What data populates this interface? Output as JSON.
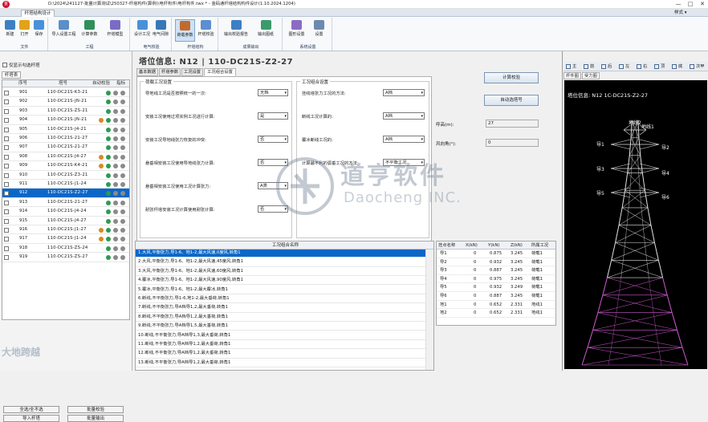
{
  "window": {
    "title": "D:\\2024\\241127-批量计算测试\\250327-杆塔构件(算例)\\电杆构件\\电杆构件.twx * - 金码通杆塔结构构件设计(1.10.2024.1204)",
    "logo_text": "金",
    "controls": [
      "—",
      "□",
      "✕"
    ]
  },
  "menu": {
    "active_tab": "杆塔结构设计",
    "skin_label": "样式 ▾"
  },
  "ribbon": {
    "groups": [
      {
        "label": "文件",
        "buttons": [
          {
            "label": "新建",
            "icon": "new-file-icon"
          },
          {
            "label": "打开",
            "icon": "folder-open-icon"
          },
          {
            "label": "保存",
            "icon": "save-icon"
          }
        ]
      },
      {
        "label": "工程",
        "buttons": [
          {
            "label": "导入设置工程",
            "icon": "import-icon"
          },
          {
            "label": "计算参数",
            "icon": "parameters-icon"
          },
          {
            "label": "杆塔模型",
            "icon": "tower-model-icon"
          }
        ]
      },
      {
        "label": "电气校验",
        "buttons": [
          {
            "label": "设计工况",
            "icon": "grid-icon"
          },
          {
            "label": "电气间隙",
            "icon": "clearance-icon"
          }
        ]
      },
      {
        "label": "杆塔结构",
        "buttons": [
          {
            "label": "荷载参数",
            "icon": "load-icon"
          },
          {
            "label": "杆塔校验",
            "icon": "check-icon"
          }
        ]
      },
      {
        "label": "成果输出",
        "buttons": [
          {
            "label": "输出校验报告",
            "icon": "report-icon"
          },
          {
            "label": "输出图纸",
            "icon": "drawing-icon"
          }
        ]
      },
      {
        "label": "系统设置",
        "buttons": [
          {
            "label": "图形设置",
            "icon": "graphics-icon"
          },
          {
            "label": "设置",
            "icon": "settings-icon"
          }
        ]
      }
    ]
  },
  "left": {
    "only_show_checked": "仅显示勾选杆塔",
    "subtab": "杆塔表",
    "columns": [
      "序号",
      "塔号",
      "自动校验",
      "指标"
    ],
    "rows": [
      {
        "no": "901",
        "code": "110-DC21S-K3-21",
        "dots": [
          "#2e9a52",
          "#8a8a8a",
          "#8a8a8a"
        ]
      },
      {
        "no": "902",
        "code": "110-DC21S-JN-21",
        "dots": [
          "#2e9a52",
          "#8a8a8a",
          "#8a8a8a"
        ]
      },
      {
        "no": "903",
        "code": "110-DC21S-ZS-21",
        "dots": [
          "#2e9a52",
          "#8a8a8a",
          "#8a8a8a"
        ]
      },
      {
        "no": "904",
        "code": "110-DC21S-JN-21",
        "dots": [
          "#d88a1f",
          "#2e9a52",
          "#8a8a8a",
          "#8a8a8a"
        ]
      },
      {
        "no": "905",
        "code": "110-DC21S-J4-21",
        "dots": [
          "#2e9a52",
          "#8a8a8a",
          "#8a8a8a"
        ]
      },
      {
        "no": "906",
        "code": "110-DC21S-21-27",
        "dots": [
          "#2e9a52",
          "#8a8a8a",
          "#8a8a8a"
        ]
      },
      {
        "no": "907",
        "code": "110-DC21S-21-27",
        "dots": [
          "#2e9a52",
          "#8a8a8a",
          "#8a8a8a"
        ]
      },
      {
        "no": "908",
        "code": "110-DC21S-J4-27",
        "dots": [
          "#d88a1f",
          "#2e9a52",
          "#8a8a8a",
          "#8a8a8a"
        ]
      },
      {
        "no": "909",
        "code": "110-DC21S-K4-21",
        "dots": [
          "#d88a1f",
          "#2e9a52",
          "#8a8a8a",
          "#8a8a8a"
        ]
      },
      {
        "no": "910",
        "code": "110-DC21S-Z3-21",
        "dots": [
          "#2e9a52",
          "#8a8a8a",
          "#8a8a8a"
        ]
      },
      {
        "no": "911",
        "code": "110-DC21S-J1-24",
        "dots": [
          "#2e9a52",
          "#8a8a8a",
          "#8a8a8a"
        ]
      },
      {
        "no": "912",
        "code": "110-DC21S-Z2-27",
        "dots": [
          "#2e9a52",
          "#8a8a8a",
          "#8a8a8a"
        ],
        "selected": true
      },
      {
        "no": "913",
        "code": "110-DC21S-21-27",
        "dots": [
          "#2e9a52",
          "#8a8a8a",
          "#8a8a8a"
        ]
      },
      {
        "no": "914",
        "code": "110-DC21S-J4-24",
        "dots": [
          "#2e9a52",
          "#8a8a8a",
          "#8a8a8a"
        ]
      },
      {
        "no": "915",
        "code": "110-DC21S-J4-27",
        "dots": [
          "#2e9a52",
          "#8a8a8a",
          "#8a8a8a"
        ]
      },
      {
        "no": "916",
        "code": "110-DC21S-J1-27",
        "dots": [
          "#d88a1f",
          "#2e9a52",
          "#8a8a8a",
          "#8a8a8a"
        ]
      },
      {
        "no": "917",
        "code": "110-DC21S-J1-24",
        "dots": [
          "#d88a1f",
          "#2e9a52",
          "#8a8a8a",
          "#8a8a8a"
        ]
      },
      {
        "no": "918",
        "code": "110-DC21S-ZS-24",
        "dots": [
          "#2e9a52",
          "#8a8a8a",
          "#8a8a8a"
        ]
      },
      {
        "no": "919",
        "code": "110-DC21S-ZS-27",
        "dots": [
          "#2e9a52",
          "#8a8a8a",
          "#8a8a8a"
        ]
      }
    ],
    "buttons": [
      "全选/全不选",
      "批量校验",
      "导入杆塔",
      "批量输出"
    ]
  },
  "center": {
    "header": "塔位信息: N12 | 110-DC21S-Z2-27",
    "tabs": [
      "基本数据",
      "杆塔参数",
      "工况设置",
      "工况组合设置"
    ],
    "left_group": "荷载工况设置",
    "fields": [
      {
        "label": "导地线工况是否按照统一的一次:",
        "value": "无档"
      },
      {
        "label": "安装工况使用过项实例工况进行计算:",
        "value": "是"
      },
      {
        "label": "安装工况导地线张力恢复的冲突:",
        "value": "否"
      },
      {
        "label": "悬垂相安装工况使用导地线张力计算:",
        "value": "否"
      },
      {
        "label": "悬垂相安装工况使用工况计算张力:",
        "value": "A类"
      },
      {
        "label": "耐张杆塔安装工况计算使用耐张计算:",
        "value": "否"
      }
    ],
    "right_group": "工况组合设置",
    "rfields": [
      {
        "label": "挂线塔张力工况的方法:",
        "value": "A档"
      },
      {
        "label": "断线工况计算的:",
        "value": "A档"
      },
      {
        "label": "覆冰断线工况的:",
        "value": "A档"
      },
      {
        "label": "计算最不利的弧垂工况的方法:",
        "value": "不平衡工况"
      }
    ],
    "side_buttons": [
      "计算校验",
      "自动选塔号"
    ],
    "side_fields": [
      {
        "label": "呼高(m):",
        "value": "27"
      },
      {
        "label": "风向角(°):",
        "value": "0"
      }
    ],
    "combos_header": "工况组合名称",
    "combos": [
      "1.大风,平衡张力,导1-6、地1-2,最大风速,0度风,转角1",
      "2.大风,平衡张力,导1-6、地1-2,最大风速,45度风,转角1",
      "3.大风,平衡张力,导1-6、地1-2,最大风速,60度风,转角1",
      "4.覆冰,平衡张力,导1-6、地1-2,最大风速,90度风,转角1",
      "5.覆冰,平衡张力,导1-6、地1-2,最大覆冰,转角1",
      "6.断线,不平衡张力,导1-6,地1-2,最大垂荷,转角1",
      "7.断线,不平衡张力,导A档导1,2,最大垂荷,转角1",
      "8.断线,不平衡张力,导A档导1,2,最大垂荷,转角1",
      "9.断线,不平衡张力,导A档导1,5,最大垂荷,转角1",
      "10.断线,不平衡张力,导A档导1,3,最大垂荷,转角1",
      "11.断线,不平衡张力,导A档导1,2,最大垂荷,转角1",
      "12.断线,不平衡张力,导A档导1,2,最大垂荷,转角1",
      "13.断线,不平衡张力,导A档导1,2,最大垂荷,转角1"
    ],
    "points_columns": [
      "挂点名称",
      "X(kN)",
      "Y(kN)",
      "Z(kN)",
      "所属工况"
    ],
    "points": [
      {
        "name": "导1",
        "x": "0",
        "y": "0.875",
        "z": "3.245",
        "k": "荷载1"
      },
      {
        "name": "导2",
        "x": "0",
        "y": "0.932",
        "z": "3.245",
        "k": "荷载1"
      },
      {
        "name": "导3",
        "x": "0",
        "y": "0.887",
        "z": "3.245",
        "k": "荷载1"
      },
      {
        "name": "导4",
        "x": "0",
        "y": "0.975",
        "z": "3.245",
        "k": "荷载1"
      },
      {
        "name": "导5",
        "x": "0",
        "y": "0.932",
        "z": "3.249",
        "k": "荷载1"
      },
      {
        "name": "导6",
        "x": "0",
        "y": "0.887",
        "z": "3.245",
        "k": "荷载1"
      },
      {
        "name": "地1",
        "x": "0",
        "y": "0.652",
        "z": "2.331",
        "k": "地线1"
      },
      {
        "name": "地2",
        "x": "0",
        "y": "0.652",
        "z": "2.331",
        "k": "地线1"
      }
    ]
  },
  "right": {
    "toolbar": [
      "主",
      "前",
      "后",
      "左",
      "右",
      "顶",
      "底",
      "次甲"
    ],
    "tabs": [
      "杆件图",
      "受力图"
    ],
    "view_title": "塔位信息: N12 1C-DC21S-Z2-27",
    "labels": [
      "地线2",
      "地线1",
      "导1",
      "导2",
      "导3",
      "导4",
      "导5",
      "导6"
    ]
  },
  "watermark": {
    "cn": "道亨软件",
    "en": "Daocheng INC.",
    "corner": "大地跨越"
  }
}
